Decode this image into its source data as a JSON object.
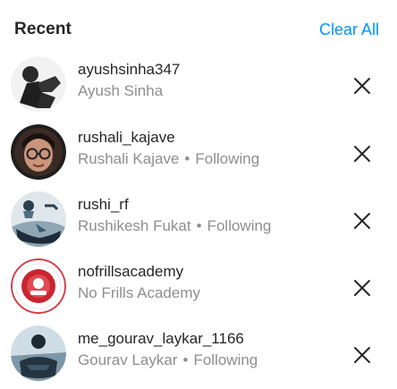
{
  "header": {
    "title": "Recent",
    "clear_all_label": "Clear All"
  },
  "colors": {
    "link": "#0095f6",
    "primary_text": "#262626",
    "secondary_text": "#8e8e8e",
    "story_ring": "#d63a44"
  },
  "recent_items": [
    {
      "username": "ayushsinha347",
      "full_name": "Ayush Sinha",
      "following": "",
      "avatar_icon": "avatar-person-silhouette"
    },
    {
      "username": "rushali_kajave",
      "full_name": "Rushali Kajave",
      "following": "Following",
      "avatar_icon": "avatar-person-glasses"
    },
    {
      "username": "rushi_rf",
      "full_name": "Rushikesh Fukat",
      "following": "Following",
      "avatar_icon": "avatar-person-outdoor"
    },
    {
      "username": "nofrillsacademy",
      "full_name": "No Frills Academy",
      "following": "",
      "avatar_icon": "avatar-brand-logo"
    },
    {
      "username": "me_gourav_laykar_1166",
      "full_name": "Gourav Laykar",
      "following": "Following",
      "avatar_icon": "avatar-person-dark"
    }
  ],
  "separator": "•",
  "remove_icon": "close-icon"
}
